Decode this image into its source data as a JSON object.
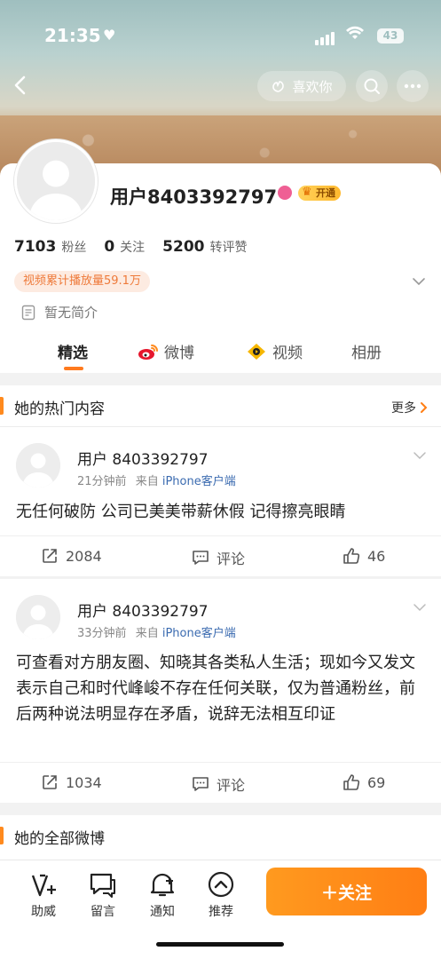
{
  "status_bar": {
    "time": "21:35",
    "battery": "43"
  },
  "header": {
    "like_label": "喜欢你"
  },
  "profile": {
    "username": "用户8403392797",
    "vip_label": "开通",
    "stats": [
      {
        "value": "7103",
        "label": "粉丝"
      },
      {
        "value": "0",
        "label": "关注"
      },
      {
        "value": "5200",
        "label": "转评赞"
      }
    ],
    "plays": "视频累计播放量59.1万",
    "bio": "暂无简介"
  },
  "tabs": [
    {
      "label": "精选",
      "active": true,
      "icon": "none"
    },
    {
      "label": "微博",
      "active": false,
      "icon": "weibo-icon"
    },
    {
      "label": "视频",
      "active": false,
      "icon": "video-icon"
    },
    {
      "label": "相册",
      "active": false,
      "icon": "none"
    }
  ],
  "hot_section": {
    "title": "她的热门内容",
    "more": "更多"
  },
  "posts": [
    {
      "name": "用户 8403392797",
      "time": "21分钟前",
      "from": "来自",
      "source": "iPhone客户端",
      "text": "无任何破防 公司已美美带薪休假 记得擦亮眼睛",
      "reposts": "2084",
      "comment_label": "评论",
      "likes": "46"
    },
    {
      "name": "用户 8403392797",
      "time": "33分钟前",
      "from": "来自",
      "source": "iPhone客户端",
      "text": "可查看对方朋友圈、知晓其各类私人生活；现如今又发文表示自己和时代峰峻不存在任何关联，仅为普通粉丝，前后两种说法明显存在矛盾，说辞无法相互印证",
      "reposts": "1034",
      "comment_label": "评论",
      "likes": "69"
    }
  ],
  "all_section": {
    "title": "她的全部微博"
  },
  "bottom_bar": {
    "items": [
      "助威",
      "留言",
      "通知",
      "推荐"
    ],
    "follow": "＋关注"
  },
  "colors": {
    "accent": "#ff7e14",
    "link": "#3b6bb0"
  }
}
